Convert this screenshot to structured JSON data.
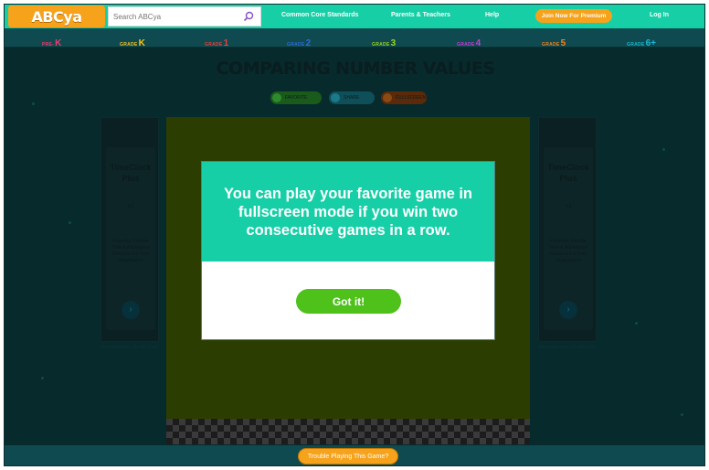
{
  "header": {
    "logo_text": "ABCya",
    "search_placeholder": "Search ABCya",
    "nav": [
      "Common Core Standards",
      "Parents & Teachers",
      "Help"
    ],
    "premium_label": "Join Now For Premium",
    "login_label": "Log In"
  },
  "grades": [
    {
      "word": "PRE-",
      "num": "K",
      "color": "#e83e6c"
    },
    {
      "word": "GRADE",
      "num": "K",
      "color": "#f6c21b"
    },
    {
      "word": "GRADE",
      "num": "1",
      "color": "#e8403c"
    },
    {
      "word": "GRADE",
      "num": "2",
      "color": "#2e6bd8"
    },
    {
      "word": "GRADE",
      "num": "3",
      "color": "#9ad21b"
    },
    {
      "word": "GRADE",
      "num": "4",
      "color": "#c23fd8"
    },
    {
      "word": "GRADE",
      "num": "5",
      "color": "#f6821b"
    },
    {
      "word": "GRADE",
      "num": "6+",
      "color": "#1bb6d2"
    }
  ],
  "game": {
    "title": "COMPARING NUMBER VALUES",
    "share_buttons": [
      "FAVORITE",
      "SHARE",
      "FULLSCREEN"
    ]
  },
  "ads": {
    "title": "TimeClock Plus",
    "rating": "4.5",
    "text": "Powerful, Flexible Time & Attendance Solutions For Your Organization",
    "caption": "Advertisement | Go Ad-Free!"
  },
  "modal": {
    "message": "You can play your favorite game in fullscreen mode if you win two consecutive games in a row.",
    "button_label": "Got it!"
  },
  "footer": {
    "trouble_label": "Trouble Playing This Game?"
  },
  "colors": {
    "teal": "#16cfa6",
    "orange": "#f6a21b",
    "green": "#4fc11b"
  }
}
